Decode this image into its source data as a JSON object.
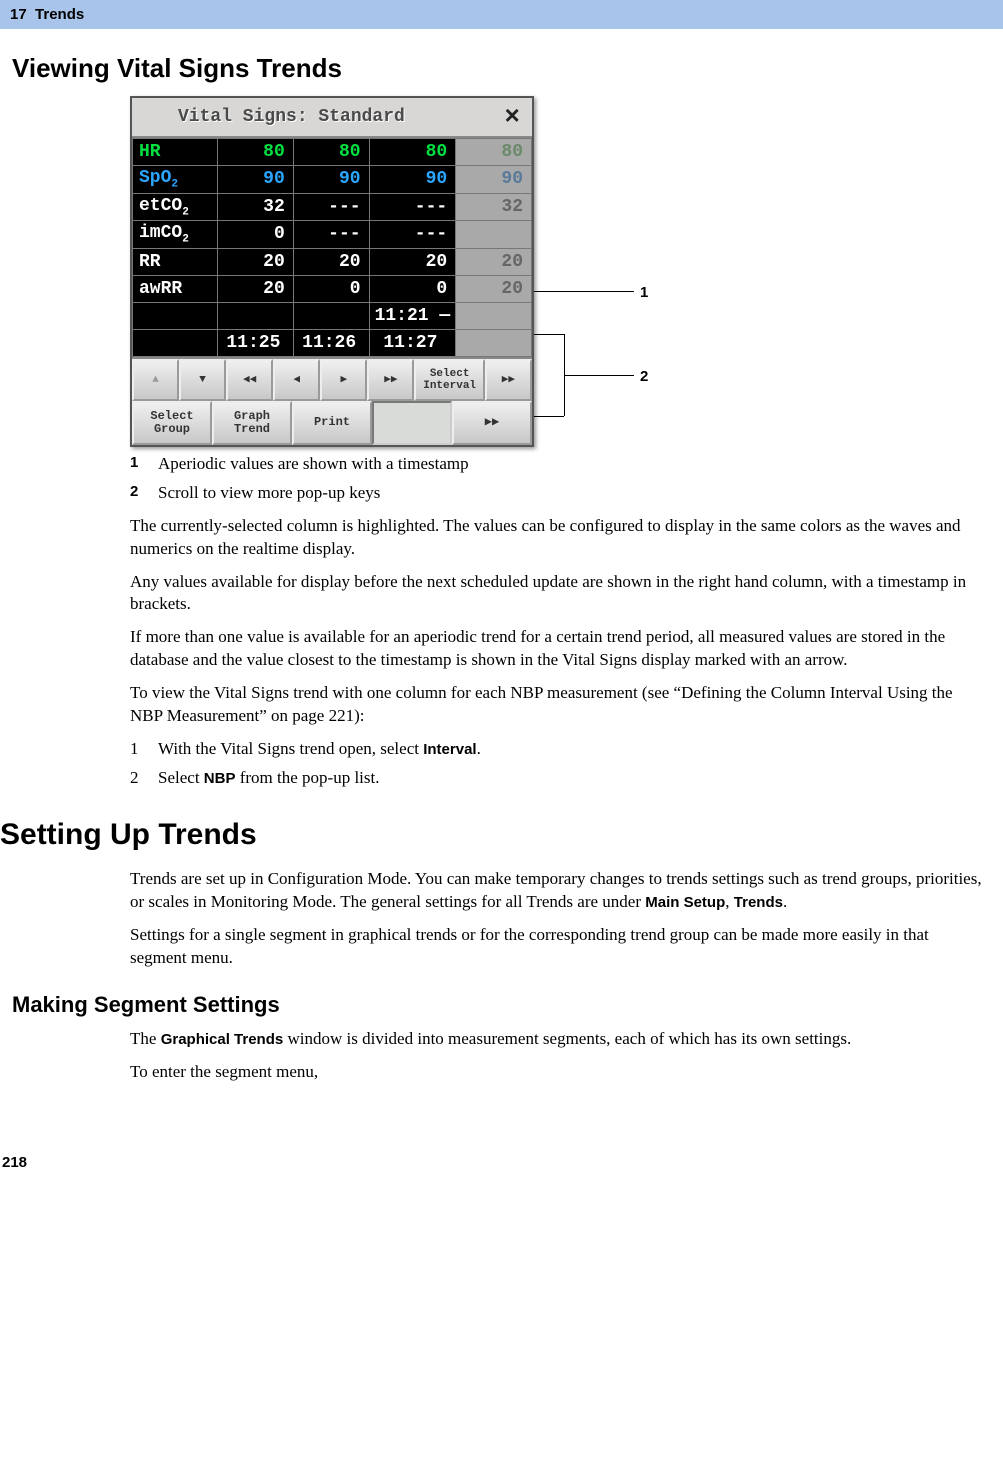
{
  "header": {
    "chapter": "17",
    "chapter_title": "Trends"
  },
  "h_viewing": "Viewing Vital Signs Trends",
  "vs": {
    "title": "Vital Signs: Standard",
    "close": "×",
    "rows": [
      {
        "label": "HR",
        "c1": "80",
        "c2": "80",
        "c3": "80",
        "c4": "80"
      },
      {
        "label": "SpO",
        "sub": "2",
        "c1": "90",
        "c2": "90",
        "c3": "90",
        "c4": "90"
      },
      {
        "label": "etCO",
        "sub": "2",
        "c1": "32",
        "c2": "---",
        "c3": "---",
        "c4": "32"
      },
      {
        "label": "imCO",
        "sub": "2",
        "c1": "0",
        "c2": "---",
        "c3": "---",
        "c4": ""
      },
      {
        "label": "RR",
        "c1": "20",
        "c2": "20",
        "c3": "20",
        "c4": "20"
      },
      {
        "label": "awRR",
        "c1": "20",
        "c2": "0",
        "c3": "0",
        "c4": "20"
      }
    ],
    "aperiodic_time": "11:21",
    "times": [
      "11:25",
      "11:26",
      "11:27",
      ""
    ],
    "toolbar1": {
      "up": "▲",
      "down": "▼",
      "ffback": "◀◀",
      "back": "◀",
      "fwd": "▶",
      "fffwd": "▶▶",
      "select_interval": "Select\nInterval",
      "more": "▶▶"
    },
    "toolbar2": {
      "select_group": "Select\nGroup",
      "graph_trend": "Graph\nTrend",
      "print": "Print",
      "more2": "▶▶"
    }
  },
  "callout1_num": "1",
  "callout2_num": "2",
  "legend1_num": "1",
  "legend1_text": "Aperiodic values are shown with a timestamp",
  "legend2_num": "2",
  "legend2_text": "Scroll to view more pop-up keys",
  "p1": "The currently-selected column is highlighted. The values can be configured to display in the same colors as the waves and numerics on the realtime display.",
  "p2": "Any values available for display before the next scheduled update are shown in the right hand column, with a timestamp in brackets.",
  "p3": "If more than one value is available for an aperiodic trend for a certain trend period, all measured values are stored in the database and the value closest to the timestamp is shown in the Vital Signs display marked with an arrow.",
  "p4": "To view the Vital Signs trend with one column for each NBP measurement (see “Defining the Column Interval Using the NBP Measurement” on page 221):",
  "step1_num": "1",
  "step1_a": "With the Vital Signs trend open, select ",
  "step1_b": "Interval",
  "step1_c": ".",
  "step2_num": "2",
  "step2_a": "Select ",
  "step2_b": "NBP",
  "step2_c": " from the pop-up list.",
  "h_setting": "Setting Up Trends",
  "p5a": "Trends are set up in Configuration Mode. You can make temporary changes to trends settings such as trend groups, priorities, or scales in Monitoring Mode. The general settings for all Trends are under ",
  "p5b": "Main Setup",
  "p5c": ", ",
  "p5d": "Trends",
  "p5e": ".",
  "p6": "Settings for a single segment in graphical trends or for the corresponding trend group can be made more easily in that segment menu.",
  "h_making": "Making Segment Settings",
  "p7a": "The ",
  "p7b": "Graphical Trends",
  "p7c": " window is divided into measurement segments, each of which has its own settings.",
  "p8": "To enter the segment menu,",
  "page_num": "218"
}
